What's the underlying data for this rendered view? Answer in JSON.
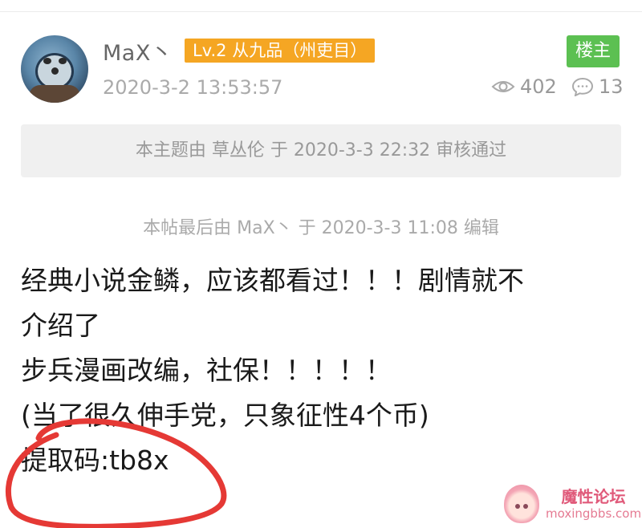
{
  "post": {
    "author": "MaX丶",
    "level_badge": "Lv.2 从九品（州吏目）",
    "owner_badge": "楼主",
    "time": "2020-3-2 13:53:57",
    "views": "402",
    "replies": "13",
    "review_notice": "本主题由 草丛伦 于 2020-3-3 22:32 审核通过",
    "edit_notice": "本帖最后由 MaX丶 于 2020-3-3 11:08 编辑",
    "body_lines": [
      "经典小说金鳞，应该都看过！！！剧情就不",
      "介绍了",
      "步兵漫画改编，社保！！！！！",
      "(当了很久伸手党，只象征性4个币)",
      "提取码:tb8x"
    ]
  },
  "watermark": {
    "name": "魔性论坛",
    "url": "moxingbbs.com"
  },
  "colors": {
    "level_badge": "#f5a623",
    "owner_badge": "#5cc052",
    "annotation_circle": "#e53935"
  },
  "icons": {
    "views": "eye-icon",
    "replies": "comment-bubble-icon"
  }
}
